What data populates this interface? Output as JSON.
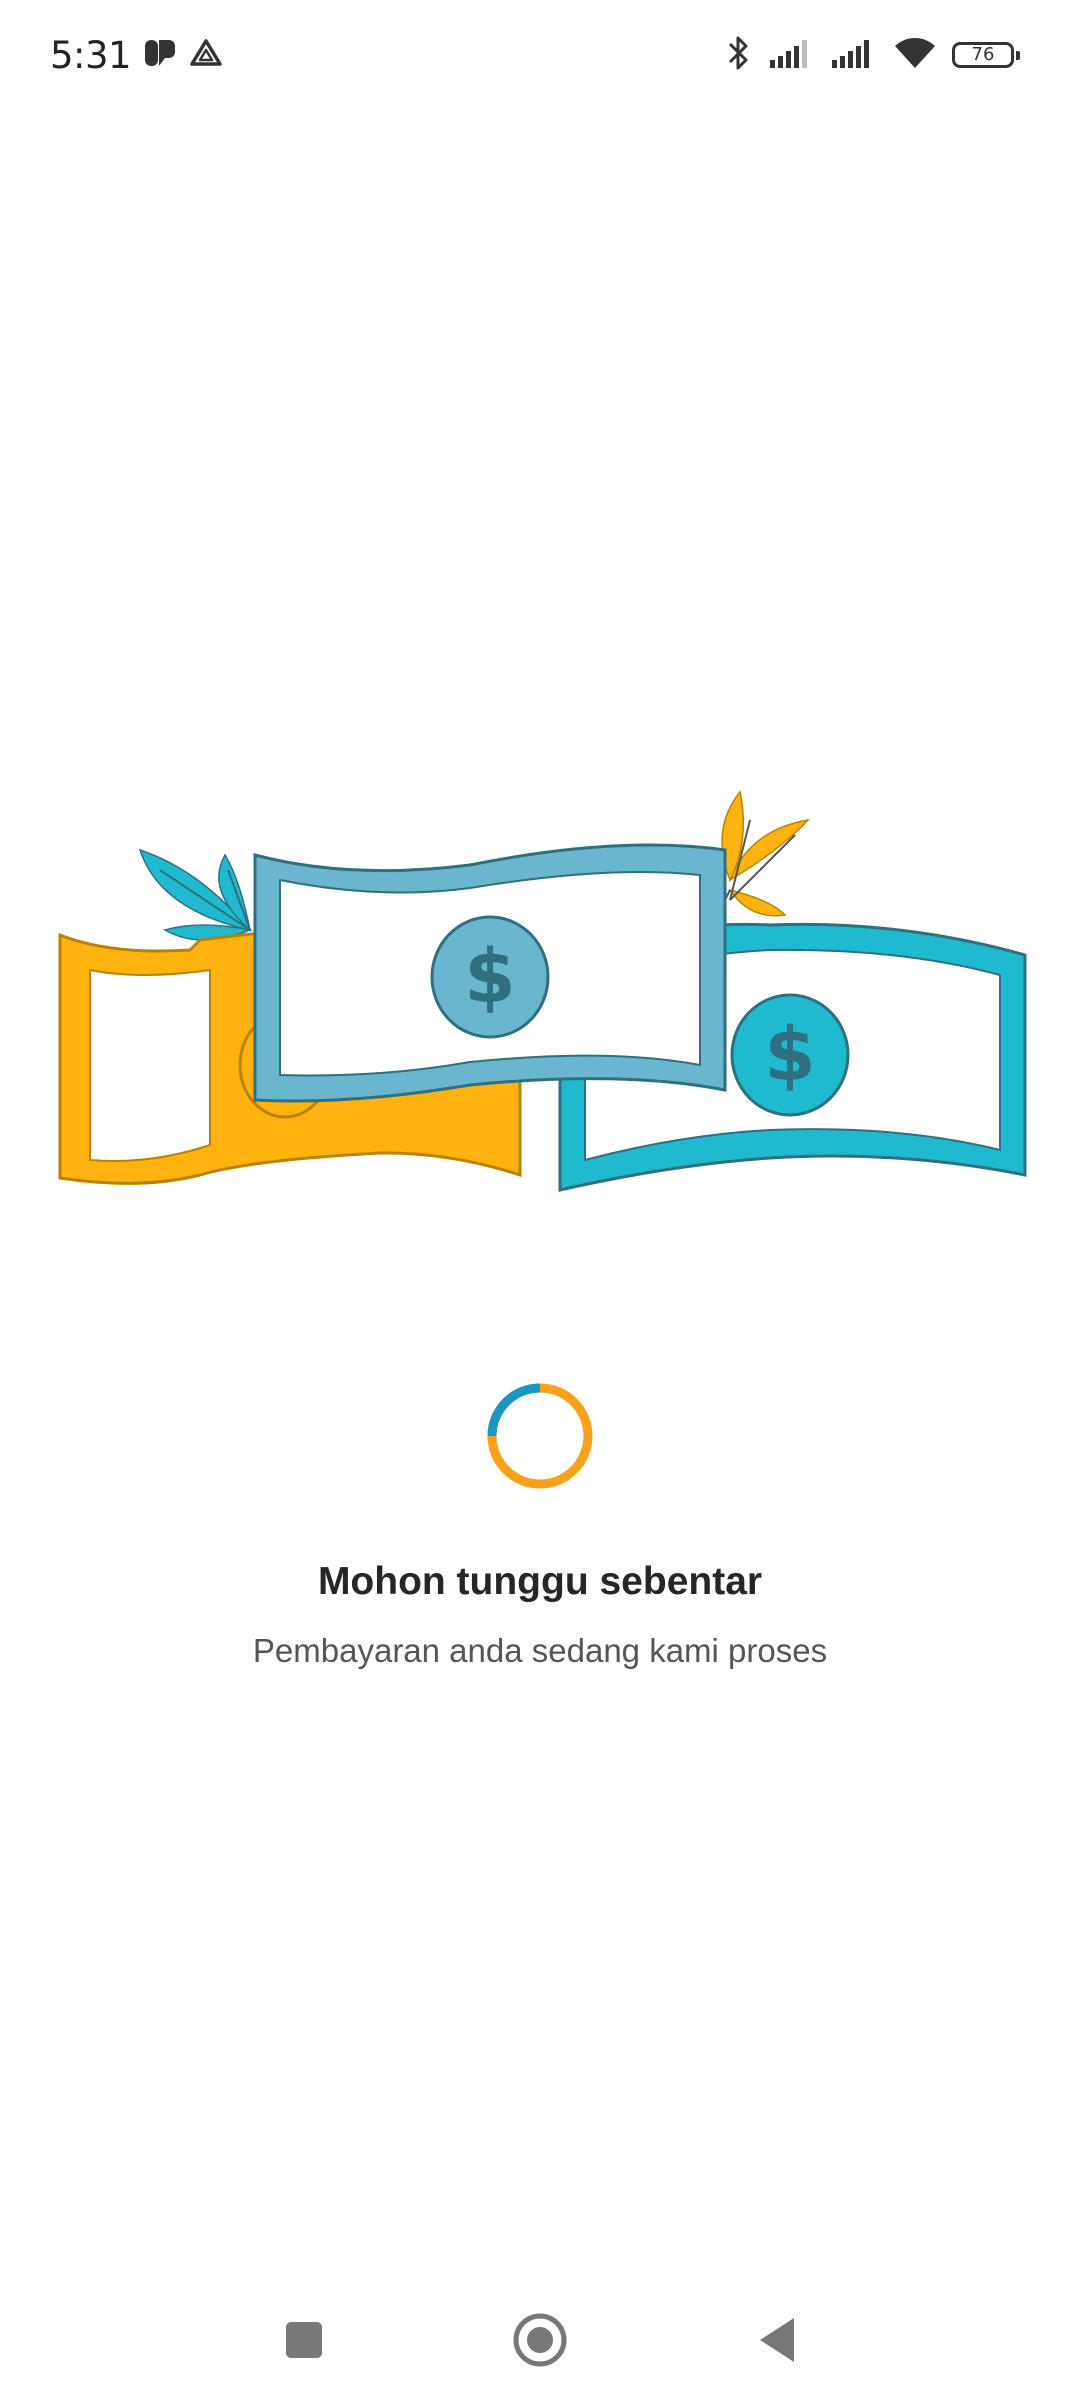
{
  "status_bar": {
    "time": "5:31",
    "battery_level": "76",
    "icons": [
      "app-notification-icon",
      "drive-icon",
      "bluetooth-icon",
      "signal-1-icon",
      "signal-2-icon",
      "wifi-icon",
      "battery-icon"
    ]
  },
  "illustration": {
    "icon": "money-bills-illustration",
    "colors": {
      "yellow_bill": "#FFB30F",
      "blue_bill": "#6BB6CF",
      "teal_bill": "#1FBACF",
      "outline": "#2F6F7F",
      "leaf_teal": "#1FBACF",
      "leaf_yellow": "#FFB30F"
    }
  },
  "loading": {
    "progress_color": "#1A96C8",
    "track_color": "#F7A11A"
  },
  "message": {
    "title": "Mohon tunggu sebentar",
    "subtitle": "Pembayaran anda sedang kami proses"
  },
  "navigation": {
    "icons": [
      "recents-icon",
      "home-icon",
      "back-icon"
    ]
  }
}
